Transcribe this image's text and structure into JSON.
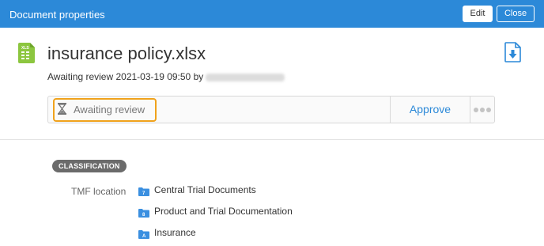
{
  "header": {
    "title": "Document properties",
    "edit_label": "Edit",
    "close_label": "Close",
    "bar_color": "#2c89d8"
  },
  "document": {
    "file_icon": "xlsx-file-icon",
    "file_icon_text": "XLS",
    "filename": "insurance policy.xlsx",
    "meta_prefix": "Awaiting review 2021-03-19 09:50 by",
    "download_icon": "download-icon"
  },
  "status": {
    "icon": "hourglass-icon",
    "label": "Awaiting review",
    "highlight_color": "#f0a21c",
    "approve_label": "Approve",
    "more_icon": "more-options-icon"
  },
  "classification": {
    "badge": "CLASSIFICATION",
    "tmf_label": "TMF location",
    "locations": [
      {
        "icon": "folder-icon",
        "folder_tag": "7",
        "label": "Central Trial Documents"
      },
      {
        "icon": "folder-icon",
        "folder_tag": "8",
        "label": "Product and Trial Documentation"
      },
      {
        "icon": "folder-icon",
        "folder_tag": "A",
        "label": "Insurance"
      }
    ]
  }
}
